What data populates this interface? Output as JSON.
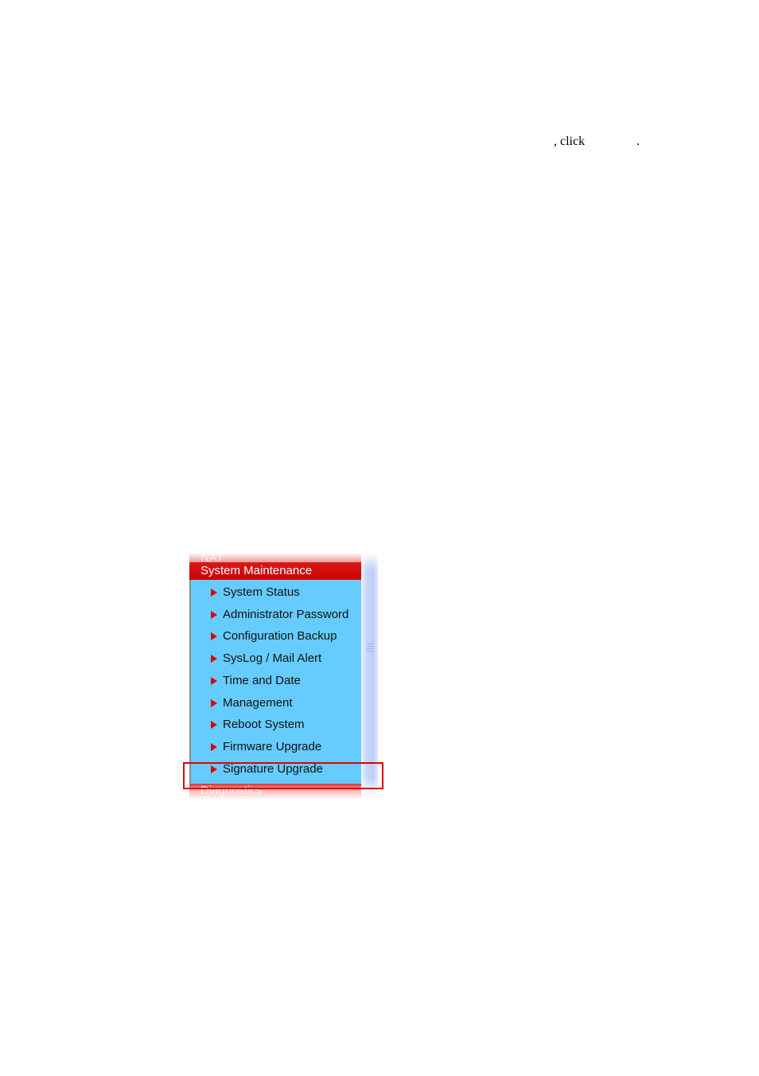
{
  "instruction": {
    "text_part1": ", click",
    "text_part2": "."
  },
  "menu": {
    "partial_top_label": "NAT",
    "section_title": "System Maintenance",
    "items": [
      {
        "label": "System Status"
      },
      {
        "label": "Administrator Password"
      },
      {
        "label": "Configuration Backup"
      },
      {
        "label": "SysLog / Mail Alert"
      },
      {
        "label": "Time and Date"
      },
      {
        "label": "Management"
      },
      {
        "label": "Reboot System"
      },
      {
        "label": "Firmware Upgrade"
      },
      {
        "label": "Signature Upgrade"
      }
    ],
    "highlighted_item": "Signature Upgrade",
    "partial_bottom_label": "Diagnostics"
  },
  "colors": {
    "section_header_bg": "#cc0000",
    "item_bg": "#66ccff",
    "arrow": "#dd0000",
    "highlight_border": "#e00000"
  }
}
